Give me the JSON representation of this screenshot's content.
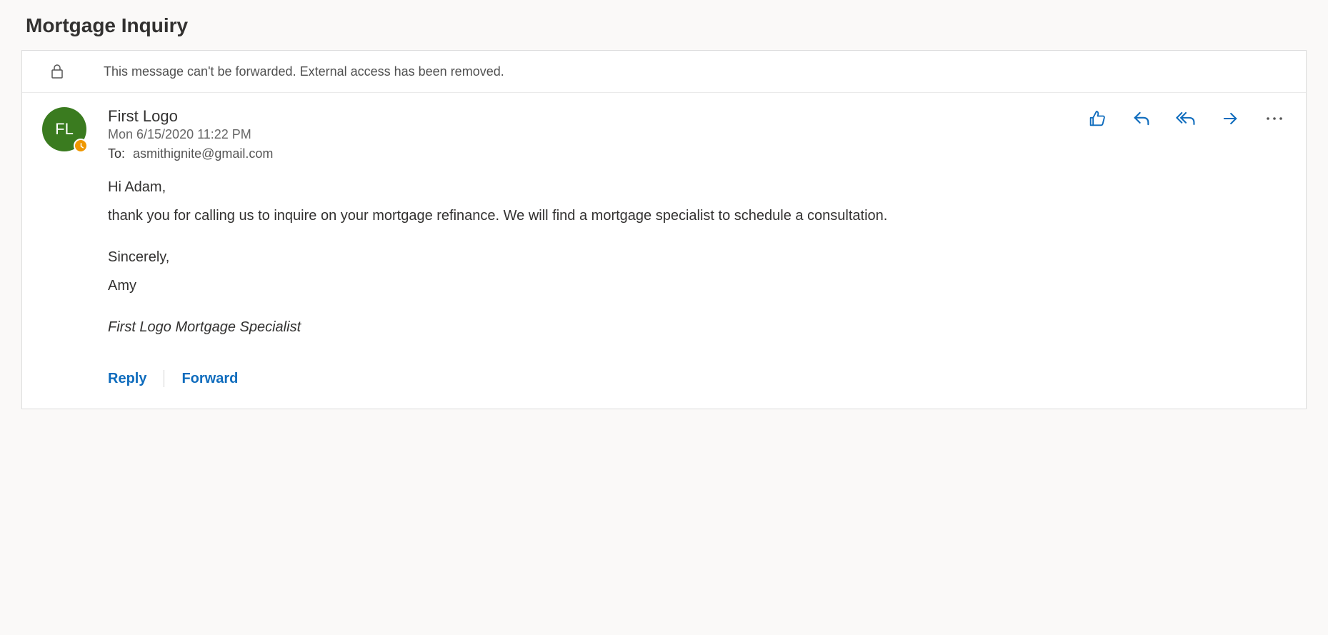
{
  "subject": "Mortgage Inquiry",
  "banner": {
    "text": "This message can't be forwarded. External access has been removed."
  },
  "sender": {
    "name": "First Logo",
    "initials": "FL"
  },
  "datetime": "Mon 6/15/2020 11:22 PM",
  "to": {
    "label": "To:",
    "value": "asmithignite@gmail.com"
  },
  "body": {
    "greeting": "Hi Adam,",
    "para1": " thank you for calling us to inquire on your mortgage refinance.  We will find a mortgage specialist to schedule a consultation.",
    "sincerely": "Sincerely,",
    "signoff_name": "Amy",
    "signature_title": "First Logo Mortgage Specialist"
  },
  "bottom": {
    "reply": "Reply",
    "forward": "Forward"
  }
}
